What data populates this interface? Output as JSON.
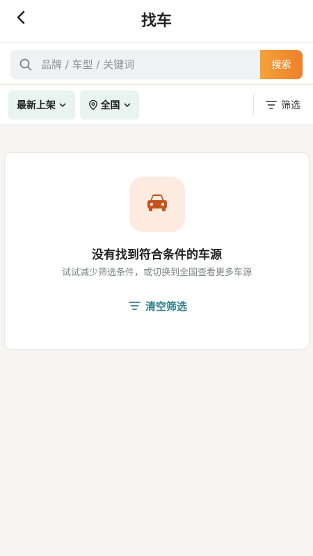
{
  "header": {
    "title": "找车"
  },
  "search": {
    "placeholder": "品牌 / 车型 / 关键词",
    "value": "",
    "button_label": "搜索"
  },
  "filters": {
    "sort_label": "最新上架",
    "region_label": "全国",
    "filter_label": "筛选"
  },
  "empty_state": {
    "title": "没有找到符合条件的车源",
    "subtitle": "试试减少筛选条件，或切换到全国查看更多车源",
    "clear_label": "清空筛选"
  },
  "colors": {
    "accent_orange": "#ef7f2b",
    "car_icon": "#c7521c",
    "chip_bg": "#e8f4ef",
    "link_teal": "#2f7f8b"
  },
  "icons": {
    "back": "chevron-left-icon",
    "search": "search-icon",
    "location": "location-pin-icon",
    "filter": "filter-lines-icon",
    "car": "car-icon"
  }
}
